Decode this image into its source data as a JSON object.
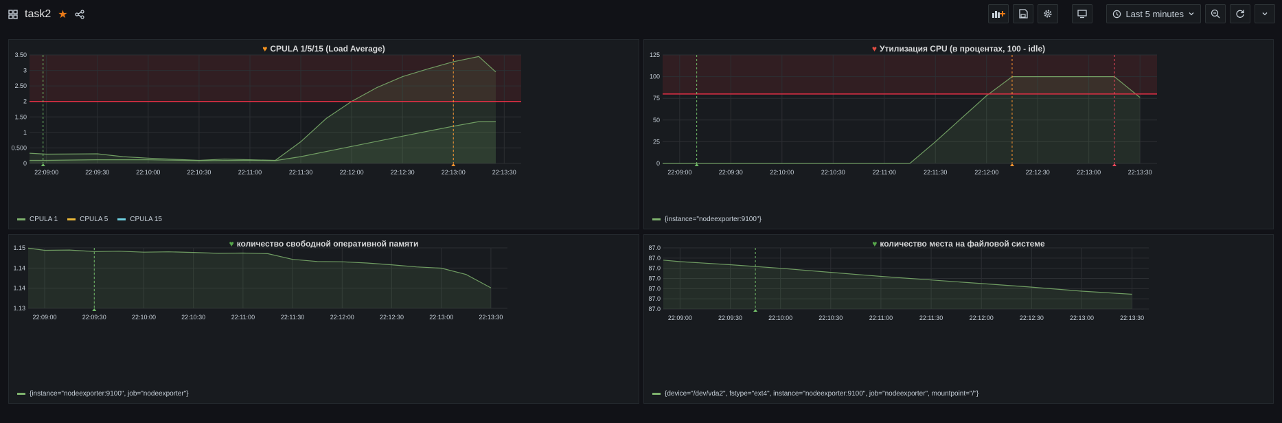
{
  "header": {
    "title": "task2",
    "time_range": "Last 5 minutes"
  },
  "panels": [
    {
      "title": "CPULA 1/5/15 (Load Average)",
      "heart_color": "#f79520",
      "legend": [
        {
          "name": "CPULA 1",
          "color": "#7eb26d"
        },
        {
          "name": "CPULA 5",
          "color": "#eab839"
        },
        {
          "name": "CPULA 15",
          "color": "#6ed0e0"
        }
      ]
    },
    {
      "title": "Утилизация CPU (в процентах, 100 - idle)",
      "heart_color": "#e24d42",
      "legend": [
        {
          "name": "{instance=\"nodeexporter:9100\"}",
          "color": "#7eb26d"
        }
      ]
    },
    {
      "title": "количество свободной оперативной памяти",
      "heart_color": "#56a64b",
      "legend": [
        {
          "name": "{instance=\"nodeexporter:9100\", job=\"nodeexporter\"}",
          "color": "#7eb26d"
        }
      ]
    },
    {
      "title": "количество места на файловой системе",
      "heart_color": "#56a64b",
      "legend": [
        {
          "name": "{device=\"/dev/vda2\", fstype=\"ext4\", instance=\"nodeexporter:9100\", job=\"nodeexporter\", mountpoint=\"/\"}",
          "color": "#7eb26d"
        }
      ]
    }
  ],
  "chart_data": [
    {
      "type": "line",
      "title": "CPULA 1/5/15 (Load Average)",
      "x_ticks": [
        "22:09:00",
        "22:09:30",
        "22:10:00",
        "22:10:30",
        "22:11:00",
        "22:11:30",
        "22:12:00",
        "22:12:30",
        "22:13:00",
        "22:13:30"
      ],
      "y_ticks": [
        "0",
        "0.500",
        "1",
        "1.50",
        "2",
        "2.50",
        "3",
        "3.50"
      ],
      "ylim": [
        0,
        3.5
      ],
      "x_range": [
        "22:08:50",
        "22:13:40"
      ],
      "threshold": 2,
      "series": [
        {
          "name": "CPULA 1",
          "color": "#7eb26d",
          "x": [
            "22:08:50",
            "22:09:00",
            "22:09:30",
            "22:09:45",
            "22:10:00",
            "22:10:30",
            "22:10:45",
            "22:11:00",
            "22:11:15",
            "22:11:30",
            "22:11:45",
            "22:12:00",
            "22:12:15",
            "22:12:30",
            "22:12:45",
            "22:13:00",
            "22:13:15",
            "22:13:25"
          ],
          "y": [
            0.33,
            0.3,
            0.31,
            0.22,
            0.17,
            0.1,
            0.14,
            0.12,
            0.1,
            0.7,
            1.45,
            2.0,
            2.45,
            2.8,
            3.05,
            3.28,
            3.45,
            2.95
          ]
        },
        {
          "name": "CPULA 15",
          "color": "#7eb26d",
          "x": [
            "22:08:50",
            "22:09:00",
            "22:09:30",
            "22:10:00",
            "22:10:30",
            "22:11:00",
            "22:11:15",
            "22:11:30",
            "22:12:00",
            "22:12:30",
            "22:13:00",
            "22:13:15",
            "22:13:25"
          ],
          "y": [
            0.1,
            0.1,
            0.12,
            0.12,
            0.09,
            0.1,
            0.09,
            0.22,
            0.55,
            0.88,
            1.2,
            1.35,
            1.35
          ]
        }
      ],
      "annotations": [
        {
          "x": "22:08:58",
          "color": "#73bf69"
        },
        {
          "x": "22:13:00",
          "color": "#ff9830"
        }
      ]
    },
    {
      "type": "line",
      "title": "Утилизация CPU (в процентах, 100 - idle)",
      "x_ticks": [
        "22:09:00",
        "22:09:30",
        "22:10:00",
        "22:10:30",
        "22:11:00",
        "22:11:30",
        "22:12:00",
        "22:12:30",
        "22:13:00",
        "22:13:30"
      ],
      "y_ticks": [
        "0",
        "25",
        "50",
        "75",
        "100",
        "125"
      ],
      "ylim": [
        0,
        125
      ],
      "x_range": [
        "22:08:50",
        "22:13:40"
      ],
      "threshold": 80,
      "series": [
        {
          "name": "{instance=\"nodeexporter:9100\"}",
          "color": "#7eb26d",
          "x": [
            "22:08:50",
            "22:09:00",
            "22:09:30",
            "22:10:00",
            "22:10:30",
            "22:11:00",
            "22:11:15",
            "22:11:30",
            "22:12:00",
            "22:12:15",
            "22:12:30",
            "22:13:00",
            "22:13:15",
            "22:13:30"
          ],
          "y": [
            0,
            0,
            0,
            0,
            0,
            0,
            0,
            25,
            78,
            100,
            100,
            100,
            100,
            76
          ]
        }
      ],
      "annotations": [
        {
          "x": "22:09:10",
          "color": "#73bf69"
        },
        {
          "x": "22:12:15",
          "color": "#ff9830"
        },
        {
          "x": "22:13:15",
          "color": "#f2495c"
        }
      ]
    },
    {
      "type": "line",
      "title": "количество свободной оперативной памяти",
      "x_ticks": [
        "22:09:00",
        "22:09:30",
        "22:10:00",
        "22:10:30",
        "22:11:00",
        "22:11:30",
        "22:12:00",
        "22:12:30",
        "22:13:00",
        "22:13:30"
      ],
      "y_ticks": [
        "1.13",
        "1.14",
        "1.14",
        "1.15"
      ],
      "ylim": [
        1.13,
        1.15
      ],
      "x_range": [
        "22:08:50",
        "22:13:40"
      ],
      "series": [
        {
          "name": "{instance=\"nodeexporter:9100\", job=\"nodeexporter\"}",
          "color": "#7eb26d",
          "x": [
            "22:08:50",
            "22:09:00",
            "22:09:15",
            "22:09:30",
            "22:09:45",
            "22:10:00",
            "22:10:15",
            "22:10:30",
            "22:10:45",
            "22:11:00",
            "22:11:15",
            "22:11:30",
            "22:11:45",
            "22:12:00",
            "22:12:15",
            "22:12:30",
            "22:12:45",
            "22:13:00",
            "22:13:15",
            "22:13:30"
          ],
          "y": [
            1.1499,
            1.1492,
            1.1493,
            1.1488,
            1.1489,
            1.1486,
            1.1487,
            1.1485,
            1.1482,
            1.1483,
            1.1481,
            1.1462,
            1.1455,
            1.1454,
            1.145,
            1.1444,
            1.1437,
            1.1433,
            1.1412,
            1.1368
          ]
        }
      ],
      "annotations": [
        {
          "x": "22:09:30",
          "color": "#73bf69"
        }
      ]
    },
    {
      "type": "line",
      "title": "количество места на файловой системе",
      "x_ticks": [
        "22:09:00",
        "22:09:30",
        "22:10:00",
        "22:10:30",
        "22:11:00",
        "22:11:30",
        "22:12:00",
        "22:12:30",
        "22:13:00",
        "22:13:30"
      ],
      "y_ticks": [
        "87.0",
        "87.0",
        "87.0",
        "87.0",
        "87.0",
        "87.0",
        "87.0"
      ],
      "ylim": [
        0,
        6
      ],
      "x_range": [
        "22:08:50",
        "22:13:40"
      ],
      "series": [
        {
          "name": "{device=\"/dev/vda2\", fstype=\"ext4\", instance=\"nodeexporter:9100\", job=\"nodeexporter\", mountpoint=\"/\"}",
          "color": "#7eb26d",
          "x": [
            "22:08:50",
            "22:09:00",
            "22:09:30",
            "22:10:00",
            "22:10:30",
            "22:11:00",
            "22:11:30",
            "22:12:00",
            "22:12:30",
            "22:13:00",
            "22:13:30"
          ],
          "y": [
            4.8,
            4.65,
            4.35,
            4.0,
            3.6,
            3.2,
            2.85,
            2.5,
            2.15,
            1.75,
            1.45
          ]
        }
      ],
      "annotations": [
        {
          "x": "22:09:45",
          "color": "#73bf69"
        }
      ]
    }
  ]
}
